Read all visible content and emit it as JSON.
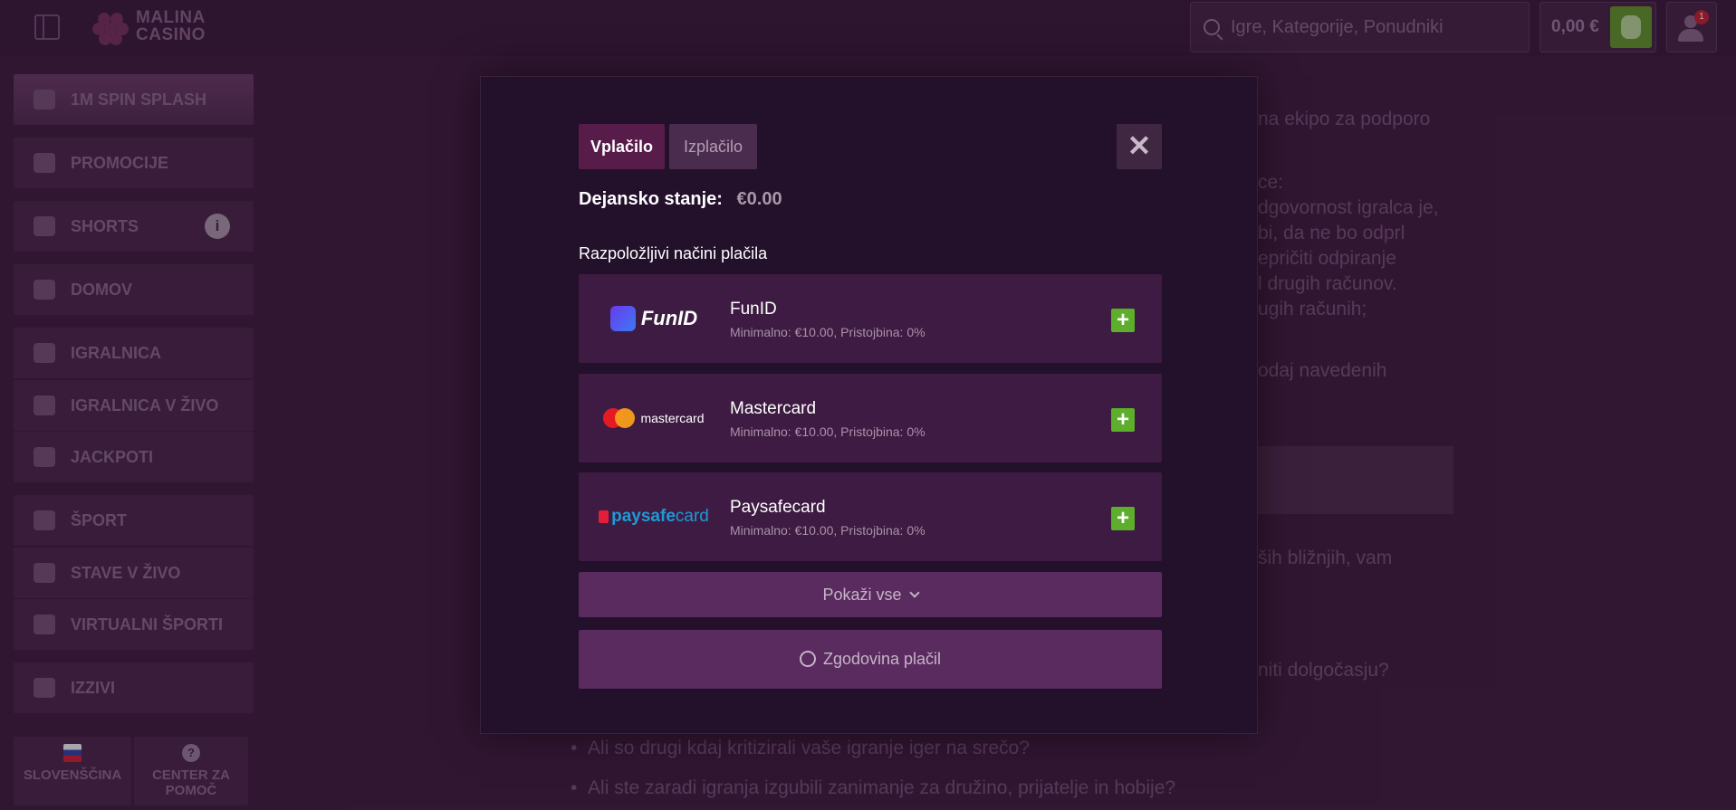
{
  "header": {
    "logo_line1": "MALINA",
    "logo_line2": "CASINO",
    "search_placeholder": "Igre, Kategorije, Ponudniki",
    "balance": "0,00 €",
    "notification_count": "1"
  },
  "sidebar": {
    "items": [
      {
        "label": "1M SPIN SPLASH",
        "icon": "rocket-icon"
      },
      {
        "label": "PROMOCIJE",
        "icon": "gift-icon"
      },
      {
        "label": "SHORTS",
        "icon": "film-icon"
      },
      {
        "label": "DOMOV",
        "icon": "home-icon"
      },
      {
        "label": "IGRALNICA",
        "icon": "cherries-icon"
      },
      {
        "label": "IGRALNICA V ŽIVO",
        "icon": "chip-icon"
      },
      {
        "label": "JACKPOTI",
        "icon": "dragon-icon"
      },
      {
        "label": "ŠPORT",
        "icon": "soccer-ball-icon"
      },
      {
        "label": "STAVE V ŽIVO",
        "icon": "live-bet-icon"
      },
      {
        "label": "VIRTUALNI ŠPORTI",
        "icon": "monitor-icon"
      },
      {
        "label": "IZZIVI",
        "icon": "award-icon"
      }
    ],
    "language": "SLOVENŠČINA",
    "help_line1": "CENTER ZA",
    "help_line2": "POMOČ"
  },
  "background": {
    "lines": [
      "na ekipo za podporo",
      "ce:",
      "dgovornost igralca je,",
      "bi, da ne bo odprl",
      "epričiti odpiranje",
      "l drugih računov.",
      "ugih računih;",
      "odaj navedenih",
      "ših bližnjih, vam",
      "niti dolgočasju?",
      "Ali so drugi kdaj kritizirali vaše igranje iger na srečo?",
      "Ali ste zaradi igranja izgubili zanimanje za družino, prijatelje in hobije?"
    ]
  },
  "modal": {
    "tabs": [
      "Vplačilo",
      "Izplačilo"
    ],
    "balance_label": "Dejansko stanje:",
    "balance_value": "€0.00",
    "methods_title": "Razpoložljivi načini plačila",
    "methods": [
      {
        "name": "FunID",
        "meta": "Minimalno: €10.00, Pristojbina: 0%",
        "logo_text": "FunID"
      },
      {
        "name": "Mastercard",
        "meta": "Minimalno: €10.00, Pristojbina: 0%",
        "logo_text": "mastercard"
      },
      {
        "name": "Paysafecard",
        "meta": "Minimalno: €10.00, Pristojbina: 0%",
        "logo_text1": "paysafe",
        "logo_text2": "card"
      }
    ],
    "show_all": "Pokaži vse",
    "history": "Zgodovina plačil"
  },
  "colors": {
    "background": "#3a1d3b",
    "modal": "#23102a",
    "active_tab": "#581c4a",
    "add_button": "#5dae2a"
  }
}
